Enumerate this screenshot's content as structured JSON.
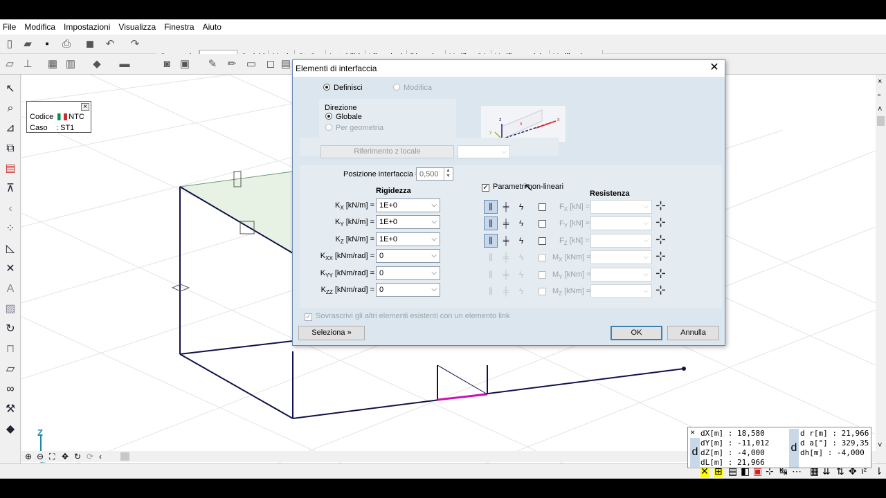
{
  "menu": [
    "File",
    "Modifica",
    "Impostazioni",
    "Visualizza",
    "Finestra",
    "Aiuto"
  ],
  "tabs": [
    "Geometria",
    "Elementi",
    "Carichi",
    "Mesh",
    "Statica",
    "Instabilità",
    "Vibrazioni",
    "Dinamica",
    "Verifica CA",
    "Verifica acciaio",
    "Verifica legno"
  ],
  "active_tab": "Elementi",
  "case_box": {
    "codice_label": "Codice",
    "codice_value": "NTC",
    "caso_label": "Caso",
    "caso_value": ": ST1"
  },
  "axes": {
    "z": "Z",
    "y": "Y",
    "x": "X"
  },
  "coords": {
    "d_letter": "d",
    "left": [
      "dX[m] : 18,580",
      "dY[m] : -11,012",
      "dZ[m] : -4,000",
      "dL[m] : 21,966"
    ],
    "right": [
      "d r[m] : 21,966",
      "d a[°] : 329,35",
      "dh[m] : -4,000"
    ]
  },
  "dialog": {
    "title": "Elementi di interfaccia",
    "mode_define": "Definisci",
    "mode_modify": "Modifica",
    "direction_label": "Direzione",
    "dir_global": "Globale",
    "dir_geometry": "Per geometria",
    "ref_z_button": "Riferimento z locale",
    "position_label": "Posizione interfaccia =",
    "position_value": "0,500",
    "stiffness_title": "Rigidezza",
    "stiffness": [
      {
        "sym": "K",
        "sub": "X",
        "unit": " [kN/m] =",
        "value": "1E+0"
      },
      {
        "sym": "K",
        "sub": "Y",
        "unit": " [kN/m] =",
        "value": "1E+0"
      },
      {
        "sym": "K",
        "sub": "Z",
        "unit": " [kN/m] =",
        "value": "1E+0"
      },
      {
        "sym": "K",
        "sub": "XX",
        "unit": " [kNm/rad] =",
        "value": "0"
      },
      {
        "sym": "K",
        "sub": "YY",
        "unit": " [kNm/rad] =",
        "value": "0"
      },
      {
        "sym": "K",
        "sub": "ZZ",
        "unit": " [kNm/rad] =",
        "value": "0"
      }
    ],
    "nonlinear_label": "Parametri non-lineari",
    "resistance_title": "Resistenza",
    "resistance": [
      {
        "sym": "F",
        "sub": "X",
        "unit": " [kN] ="
      },
      {
        "sym": "F",
        "sub": "Y",
        "unit": " [kN] ="
      },
      {
        "sym": "F",
        "sub": "Z",
        "unit": " [kN] ="
      },
      {
        "sym": "M",
        "sub": "X",
        "unit": " [kNm] ="
      },
      {
        "sym": "M",
        "sub": "Y",
        "unit": " [kNm] ="
      },
      {
        "sym": "M",
        "sub": "Z",
        "unit": " [kNm] ="
      }
    ],
    "overwrite_label": "Sovrascrivi gli altri elementi esistenti con un elemento link",
    "select_button": "Seleziona",
    "ok_button": "OK",
    "cancel_button": "Annulla"
  }
}
